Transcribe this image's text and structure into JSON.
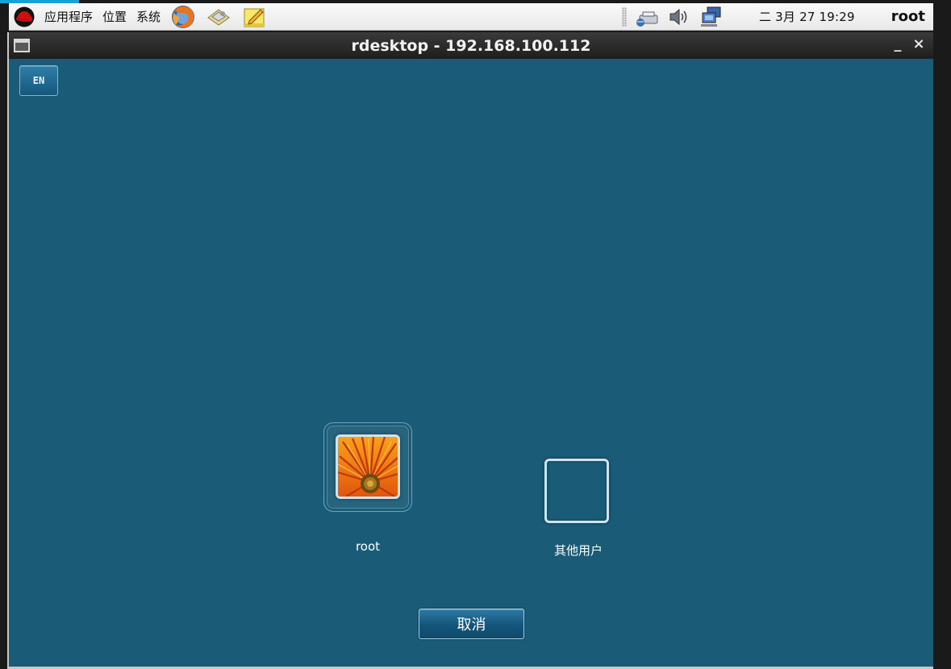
{
  "panel": {
    "menus": [
      "应用程序",
      "位置",
      "系统"
    ],
    "launchers": [
      "firefox-icon",
      "mail-icon",
      "notes-icon"
    ],
    "tray_icons": [
      "network-printer-icon",
      "volume-icon",
      "network-icon"
    ],
    "clock": "二 3月 27 19:29",
    "user": "root"
  },
  "window": {
    "title": "rdesktop - 192.168.100.112",
    "minimize_label": "_",
    "close_label": "×"
  },
  "login": {
    "language": "EN",
    "users": [
      {
        "name": "root",
        "avatar": "flower-photo"
      },
      {
        "name": "其他用户",
        "avatar": "blank"
      }
    ],
    "cancel_label": "取消"
  },
  "colors": {
    "desktop_bg": "#1a5c78",
    "panel_bg": "#f0f0f0",
    "titlebar_bg": "#2a2a2a",
    "button_blue": "#15587c"
  }
}
